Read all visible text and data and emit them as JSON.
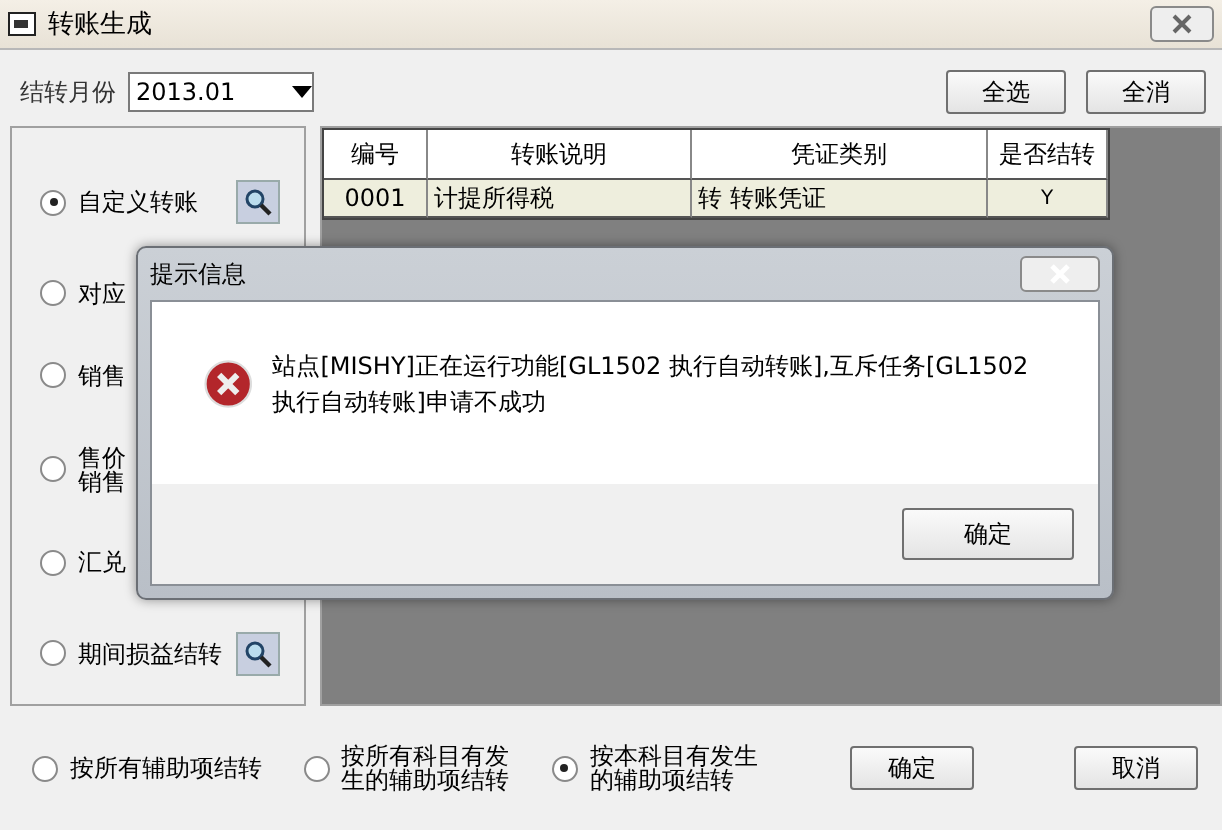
{
  "window": {
    "title": "转账生成"
  },
  "month": {
    "label": "结转月份",
    "value": "2013.01"
  },
  "top_buttons": [
    "全选",
    "全消"
  ],
  "transfer_types": [
    {
      "lines": [
        "自定义转账"
      ],
      "selected": true,
      "lookup": true
    },
    {
      "lines": [
        "对应"
      ],
      "selected": false,
      "lookup": false
    },
    {
      "lines": [
        "销售"
      ],
      "selected": false,
      "lookup": false
    },
    {
      "lines": [
        "售价",
        "销售"
      ],
      "selected": false,
      "lookup": false
    },
    {
      "lines": [
        "汇兑"
      ],
      "selected": false,
      "lookup": false
    },
    {
      "lines": [
        "期间损益结转"
      ],
      "selected": false,
      "lookup": true
    }
  ],
  "table": {
    "columns": [
      "编号",
      "转账说明",
      "凭证类别",
      "是否结转"
    ],
    "rows": [
      [
        "0001",
        "计提所得税",
        "转 转账凭证",
        "Y"
      ]
    ]
  },
  "aux_options": [
    {
      "lines": [
        "按所有辅助项结转"
      ],
      "selected": false
    },
    {
      "lines": [
        "按所有科目有发",
        "生的辅助项结转"
      ],
      "selected": false
    },
    {
      "lines": [
        "按本科目有发生",
        "的辅助项结转"
      ],
      "selected": true
    }
  ],
  "buttons": [
    "确定",
    "取消"
  ],
  "dialog": {
    "title": "提示信息",
    "message": "站点[MISHY]正在运行功能[GL1502 执行自动转账],互斥任务[GL1502 执行自动转账]申请不成功",
    "button": "确定"
  }
}
